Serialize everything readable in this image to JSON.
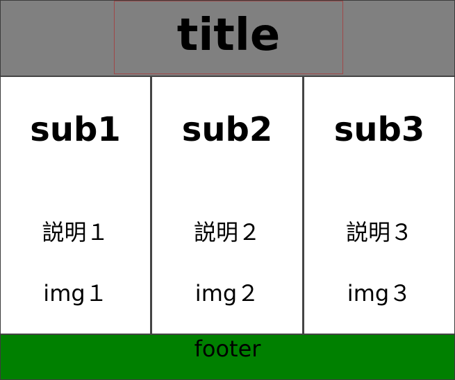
{
  "header": {
    "title": "title",
    "background_color": "#808080",
    "title_border_color": "#a04848"
  },
  "columns": [
    {
      "subtitle": "sub1",
      "description": "説明１",
      "image_label": "img１"
    },
    {
      "subtitle": "sub2",
      "description": "説明２",
      "image_label": "img２"
    },
    {
      "subtitle": "sub3",
      "description": "説明３",
      "image_label": "img３"
    }
  ],
  "footer": {
    "label": "footer",
    "background_color": "#008000"
  }
}
